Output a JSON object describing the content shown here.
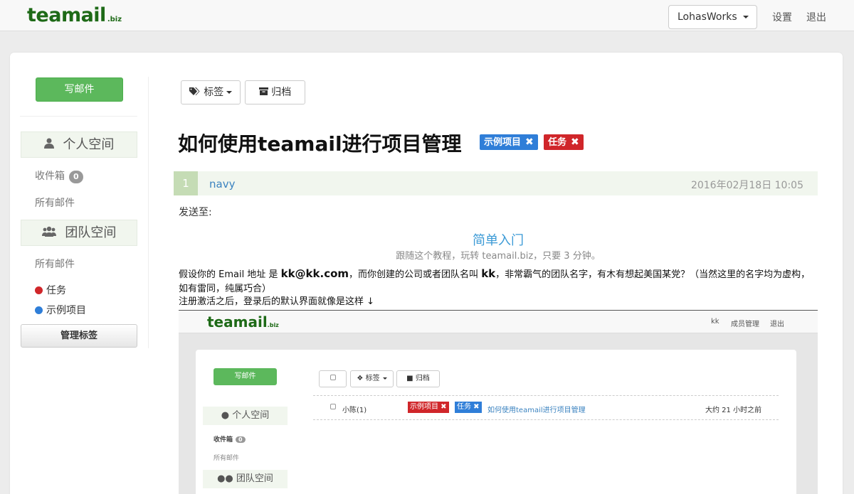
{
  "topnav": {
    "logo": "teamail",
    "logo_suffix": ".biz",
    "account_button": "LohasWorks",
    "settings": "设置",
    "logout": "退出"
  },
  "sidebar": {
    "compose": "写邮件",
    "personal_section": "个人空间",
    "inbox": "收件箱",
    "inbox_count": "0",
    "all_mail_personal": "所有邮件",
    "team_section": "团队空间",
    "all_mail_team": "所有邮件",
    "tags": [
      {
        "label": "任务",
        "color": "#d0262a"
      },
      {
        "label": "示例项目",
        "color": "#2f7ed8"
      }
    ],
    "manage_tags": "管理标签"
  },
  "toolbar": {
    "tags_button": "标签",
    "archive_button": "归档"
  },
  "message": {
    "subject": "如何使用teamail进行项目管理",
    "labels": [
      {
        "text": "示例项目",
        "color": "#2f7ed8"
      },
      {
        "text": "任务",
        "color": "#d0262a"
      }
    ],
    "number": "1",
    "sender": "navy",
    "date": "2016年02月18日 10:05",
    "send_to": "发送至:",
    "intro_title": "简单入门",
    "intro_subtitle": "跟随这个教程，玩转 teamail.biz，只要 3 分钟。",
    "para1_a": "假设你的 Email 地址 是 ",
    "para1_email": "kk@kk.com",
    "para1_b": "，而你创建的公司或者团队名叫 ",
    "para1_team": "kk",
    "para1_c": "，非常霸气的团队名字，有木有想起美国某党？（当然这里的名字均为虚构，如有雷同，纯属巧合）",
    "para2": "注册激活之后，登录后的默认界面就像是这样 ↓"
  },
  "screenshot": {
    "logo": "teamail",
    "logo_suffix": ".biz",
    "nav_user": "kk",
    "nav_members": "成员管理",
    "nav_logout": "退出",
    "compose": "写邮件",
    "personal_section": "个人空间",
    "inbox": "收件箱",
    "inbox_count": "0",
    "all_mail": "所有邮件",
    "team_section": "团队空间",
    "tags_button": "标签",
    "archive_button": "归档",
    "row_sender": "小陈(1)",
    "row_label1": "示例项目",
    "row_label2": "任务",
    "row_subject": "如何使用teamail进行项目管理",
    "row_time": "大约 21 小时之前"
  }
}
